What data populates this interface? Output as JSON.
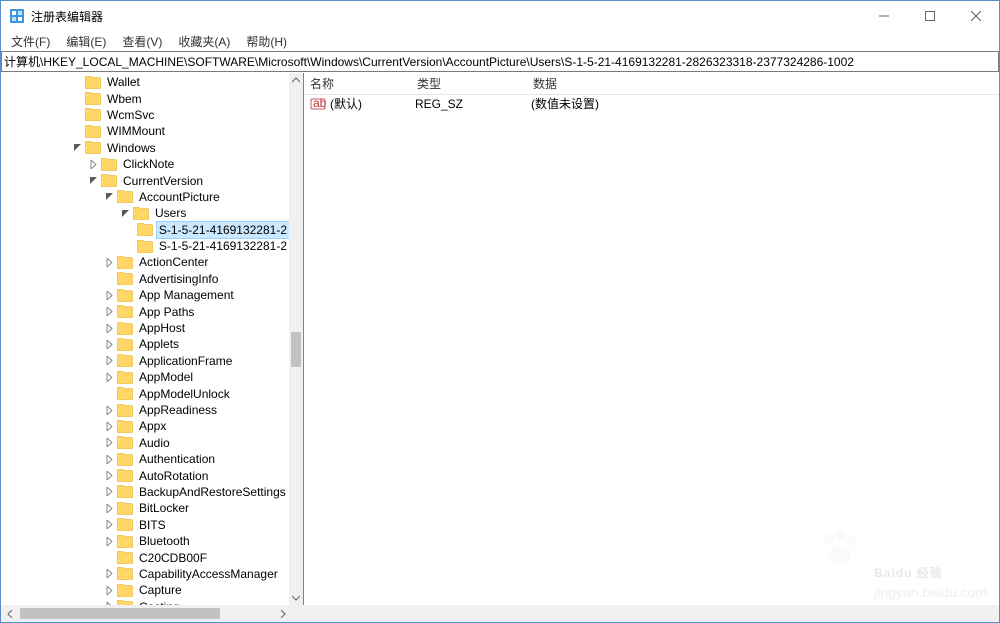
{
  "window": {
    "title": "注册表编辑器"
  },
  "menu": {
    "file": "文件(F)",
    "edit": "编辑(E)",
    "view": "查看(V)",
    "fav": "收藏夹(A)",
    "help": "帮助(H)"
  },
  "address": {
    "path": "计算机\\HKEY_LOCAL_MACHINE\\SOFTWARE\\Microsoft\\Windows\\CurrentVersion\\AccountPicture\\Users\\S-1-5-21-4169132281-2826323318-2377324286-1002"
  },
  "columns": {
    "name": "名称",
    "type": "类型",
    "data": "数据"
  },
  "value_row": {
    "name": "(默认)",
    "type": "REG_SZ",
    "data": "(数值未设置)"
  },
  "tree": {
    "items": [
      {
        "depth": 4,
        "twist": "",
        "label": "Wallet"
      },
      {
        "depth": 4,
        "twist": "",
        "label": "Wbem"
      },
      {
        "depth": 4,
        "twist": "",
        "label": "WcmSvc"
      },
      {
        "depth": 4,
        "twist": "",
        "label": "WIMMount"
      },
      {
        "depth": 4,
        "twist": "open",
        "label": "Windows"
      },
      {
        "depth": 5,
        "twist": "closed",
        "label": "ClickNote"
      },
      {
        "depth": 5,
        "twist": "open",
        "label": "CurrentVersion"
      },
      {
        "depth": 6,
        "twist": "open",
        "label": "AccountPicture"
      },
      {
        "depth": 7,
        "twist": "open",
        "label": "Users"
      },
      {
        "depth": 8,
        "twist": "",
        "label": "S-1-5-21-4169132281-2",
        "sel": true
      },
      {
        "depth": 8,
        "twist": "",
        "label": "S-1-5-21-4169132281-2"
      },
      {
        "depth": 6,
        "twist": "closed",
        "label": "ActionCenter"
      },
      {
        "depth": 6,
        "twist": "",
        "label": "AdvertisingInfo"
      },
      {
        "depth": 6,
        "twist": "closed",
        "label": "App Management"
      },
      {
        "depth": 6,
        "twist": "closed",
        "label": "App Paths"
      },
      {
        "depth": 6,
        "twist": "closed",
        "label": "AppHost"
      },
      {
        "depth": 6,
        "twist": "closed",
        "label": "Applets"
      },
      {
        "depth": 6,
        "twist": "closed",
        "label": "ApplicationFrame"
      },
      {
        "depth": 6,
        "twist": "closed",
        "label": "AppModel"
      },
      {
        "depth": 6,
        "twist": "",
        "label": "AppModelUnlock"
      },
      {
        "depth": 6,
        "twist": "closed",
        "label": "AppReadiness"
      },
      {
        "depth": 6,
        "twist": "closed",
        "label": "Appx"
      },
      {
        "depth": 6,
        "twist": "closed",
        "label": "Audio"
      },
      {
        "depth": 6,
        "twist": "closed",
        "label": "Authentication"
      },
      {
        "depth": 6,
        "twist": "closed",
        "label": "AutoRotation"
      },
      {
        "depth": 6,
        "twist": "closed",
        "label": "BackupAndRestoreSettings"
      },
      {
        "depth": 6,
        "twist": "closed",
        "label": "BitLocker"
      },
      {
        "depth": 6,
        "twist": "closed",
        "label": "BITS"
      },
      {
        "depth": 6,
        "twist": "closed",
        "label": "Bluetooth"
      },
      {
        "depth": 6,
        "twist": "",
        "label": "C20CDB00F"
      },
      {
        "depth": 6,
        "twist": "closed",
        "label": "CapabilityAccessManager"
      },
      {
        "depth": 6,
        "twist": "closed",
        "label": "Capture"
      },
      {
        "depth": 6,
        "twist": "closed",
        "label": "Casting"
      }
    ]
  },
  "watermark": {
    "brand": "Baidu 经验",
    "url": "jingyan.baidu.com"
  }
}
